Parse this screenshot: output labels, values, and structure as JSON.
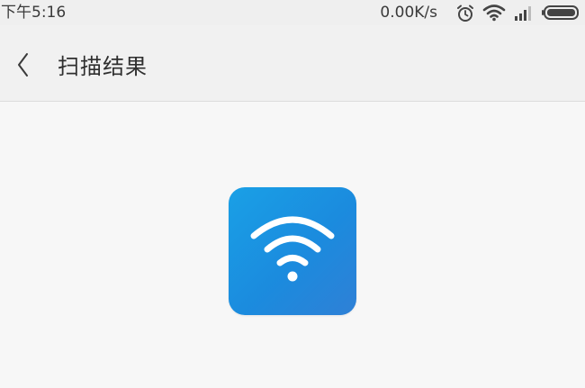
{
  "status_bar": {
    "time": "下午5:16",
    "net_speed": "0.00K/s",
    "icons": [
      "alarm-icon",
      "wifi-icon",
      "signal-icon",
      "battery-icon"
    ]
  },
  "app_bar": {
    "back_icon": "chevron-left-icon",
    "title": "扫描结果"
  },
  "content": {
    "result_icon": "wifi-icon",
    "icon_colors": {
      "gradient_start": "#1aa0e6",
      "gradient_end": "#2f80d6",
      "glyph": "#ffffff"
    }
  }
}
